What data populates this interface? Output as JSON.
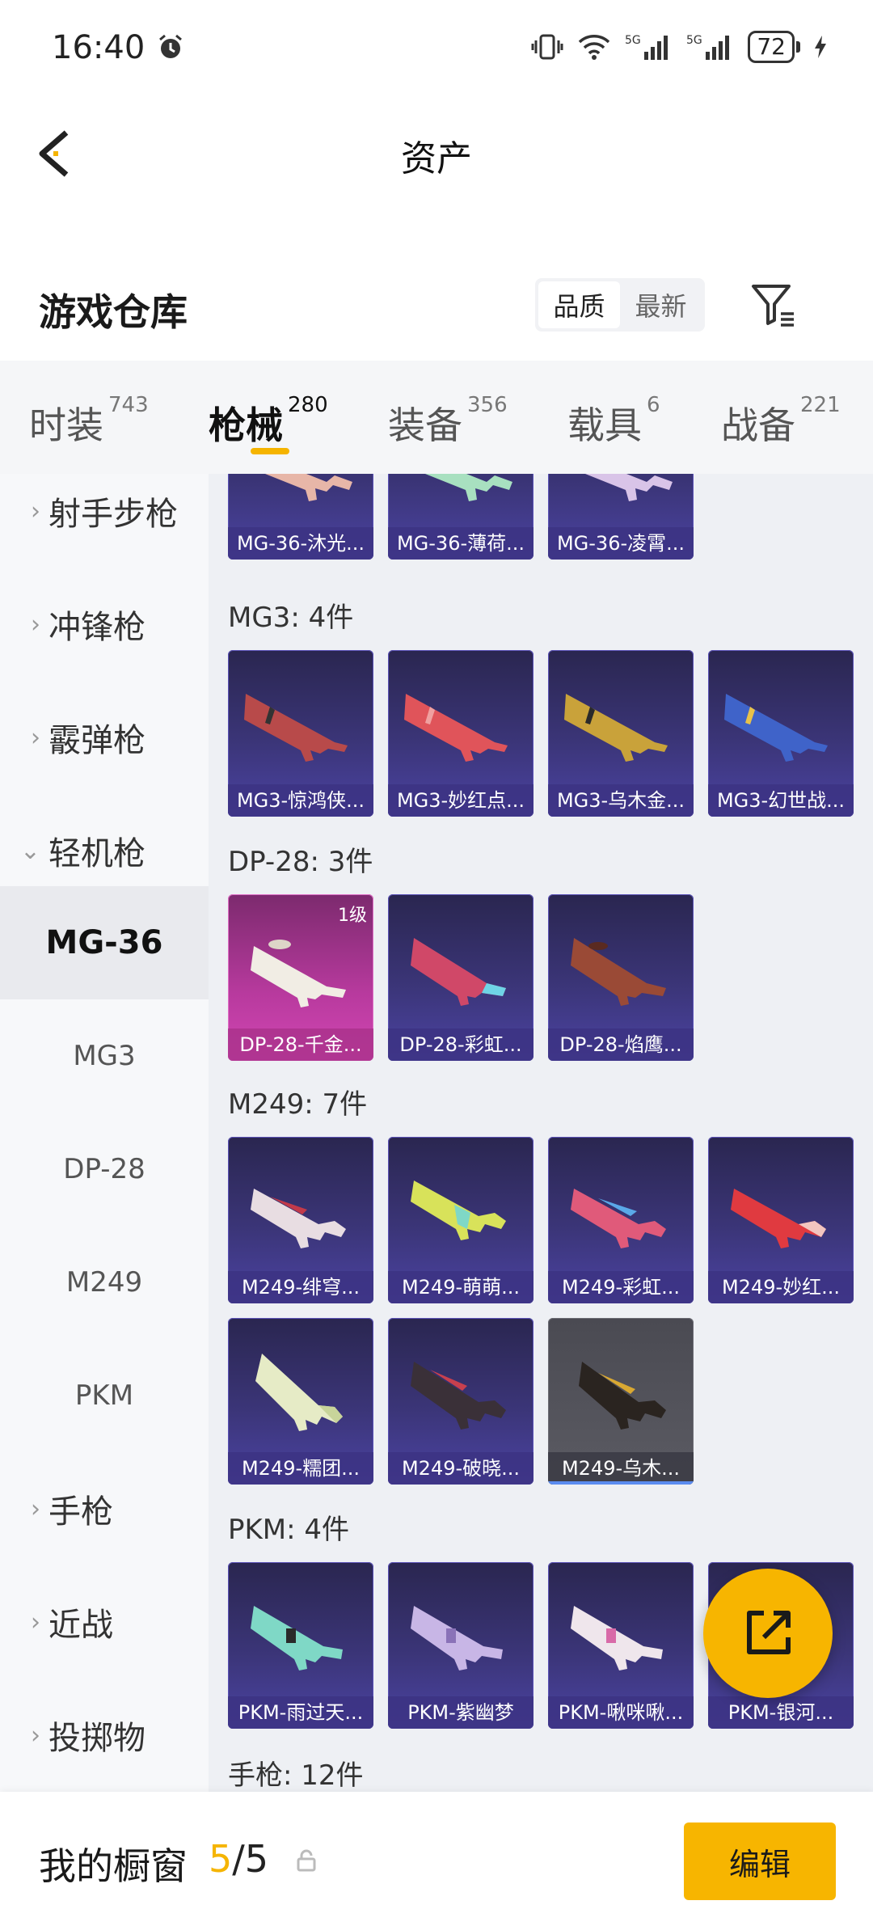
{
  "status": {
    "time": "16:40",
    "battery": "72"
  },
  "header": {
    "title": "资产"
  },
  "section": {
    "title": "游戏仓库",
    "sort_options": [
      "品质",
      "最新"
    ]
  },
  "tabs": [
    {
      "label": "时装",
      "count": "743"
    },
    {
      "label": "枪械",
      "count": "280"
    },
    {
      "label": "装备",
      "count": "356"
    },
    {
      "label": "载具",
      "count": "6"
    },
    {
      "label": "战备",
      "count": "221"
    }
  ],
  "sidebar": {
    "categories": [
      "射手步枪",
      "冲锋枪",
      "霰弹枪",
      "轻机枪",
      "手枪",
      "近战",
      "投掷物"
    ],
    "subs": [
      "MG-36",
      "MG3",
      "DP-28",
      "M249",
      "PKM"
    ]
  },
  "groups": {
    "g0": {
      "items": [
        "MG-36-沐光...",
        "MG-36-薄荷...",
        "MG-36-凌霄..."
      ]
    },
    "g1": {
      "label": "MG3: 4件",
      "items": [
        "MG3-惊鸿侠...",
        "MG3-妙红点...",
        "MG3-乌木金...",
        "MG3-幻世战..."
      ]
    },
    "g2": {
      "label": "DP-28: 3件",
      "level": "1级",
      "items": [
        "DP-28-千金...",
        "DP-28-彩虹...",
        "DP-28-焰鹰..."
      ]
    },
    "g3": {
      "label": "M249: 7件",
      "items": [
        "M249-绯穹...",
        "M249-萌萌...",
        "M249-彩虹...",
        "M249-妙红...",
        "M249-糯团...",
        "M249-破晓...",
        "M249-乌木..."
      ]
    },
    "g4": {
      "label": "PKM: 4件",
      "items": [
        "PKM-雨过天...",
        "PKM-紫幽梦",
        "PKM-啾咪啾...",
        "PKM-银河..."
      ]
    },
    "g5": {
      "label": "手枪: 12件"
    }
  },
  "bottom": {
    "showcase_label": "我的橱窗",
    "showcase_current": "5",
    "showcase_total": "/5",
    "edit_label": "编辑"
  },
  "colors": {
    "accent": "#f7b500",
    "card_purple": "#3b3578",
    "card_pink": "#b83a9e"
  }
}
